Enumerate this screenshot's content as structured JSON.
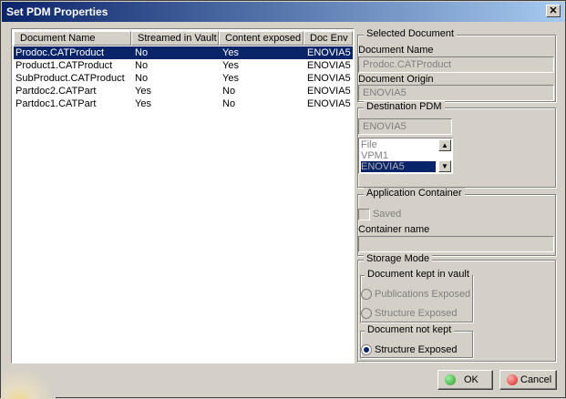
{
  "window": {
    "title": "Set PDM Properties",
    "close_glyph": "✕"
  },
  "table": {
    "headers": [
      "Document Name",
      "Streamed in Vault",
      "Content exposed",
      "Doc Env"
    ],
    "rows": [
      [
        "Prodoc.CATProduct",
        "No",
        "Yes",
        "ENOVIA5"
      ],
      [
        "Product1.CATProduct",
        "No",
        "Yes",
        "ENOVIA5"
      ],
      [
        "SubProduct.CATProduct",
        "No",
        "Yes",
        "ENOVIA5"
      ],
      [
        "Partdoc2.CATPart",
        "Yes",
        "No",
        "ENOVIA5"
      ],
      [
        "Partdoc1.CATPart",
        "Yes",
        "No",
        "ENOVIA5"
      ]
    ]
  },
  "selected_document": {
    "legend": "Selected Document",
    "name_label": "Document Name",
    "name_value": "Prodoc.CATProduct",
    "origin_label": "Document Origin",
    "origin_value": "ENOVIA5"
  },
  "destination_pdm": {
    "legend": "Destination PDM",
    "value": "ENOVIA5",
    "options": [
      "File",
      "VPM1",
      "ENOVIA5"
    ]
  },
  "application_container": {
    "legend": "Application Container",
    "saved_label": "Saved",
    "container_label": "Container name",
    "container_value": ""
  },
  "storage_mode": {
    "legend": "Storage Mode",
    "kept_legend": "Document kept in vault",
    "publications_label": "Publications Exposed",
    "structure_label": "Structure Exposed",
    "not_kept_legend": "Document not kept",
    "not_kept_structure_label": "Structure Exposed"
  },
  "buttons": {
    "ok": "OK",
    "cancel": "Cancel"
  },
  "colors": {
    "ok_icon": "#2a9d2a",
    "cancel_icon": "#d02020",
    "selection": "#0a246a"
  }
}
